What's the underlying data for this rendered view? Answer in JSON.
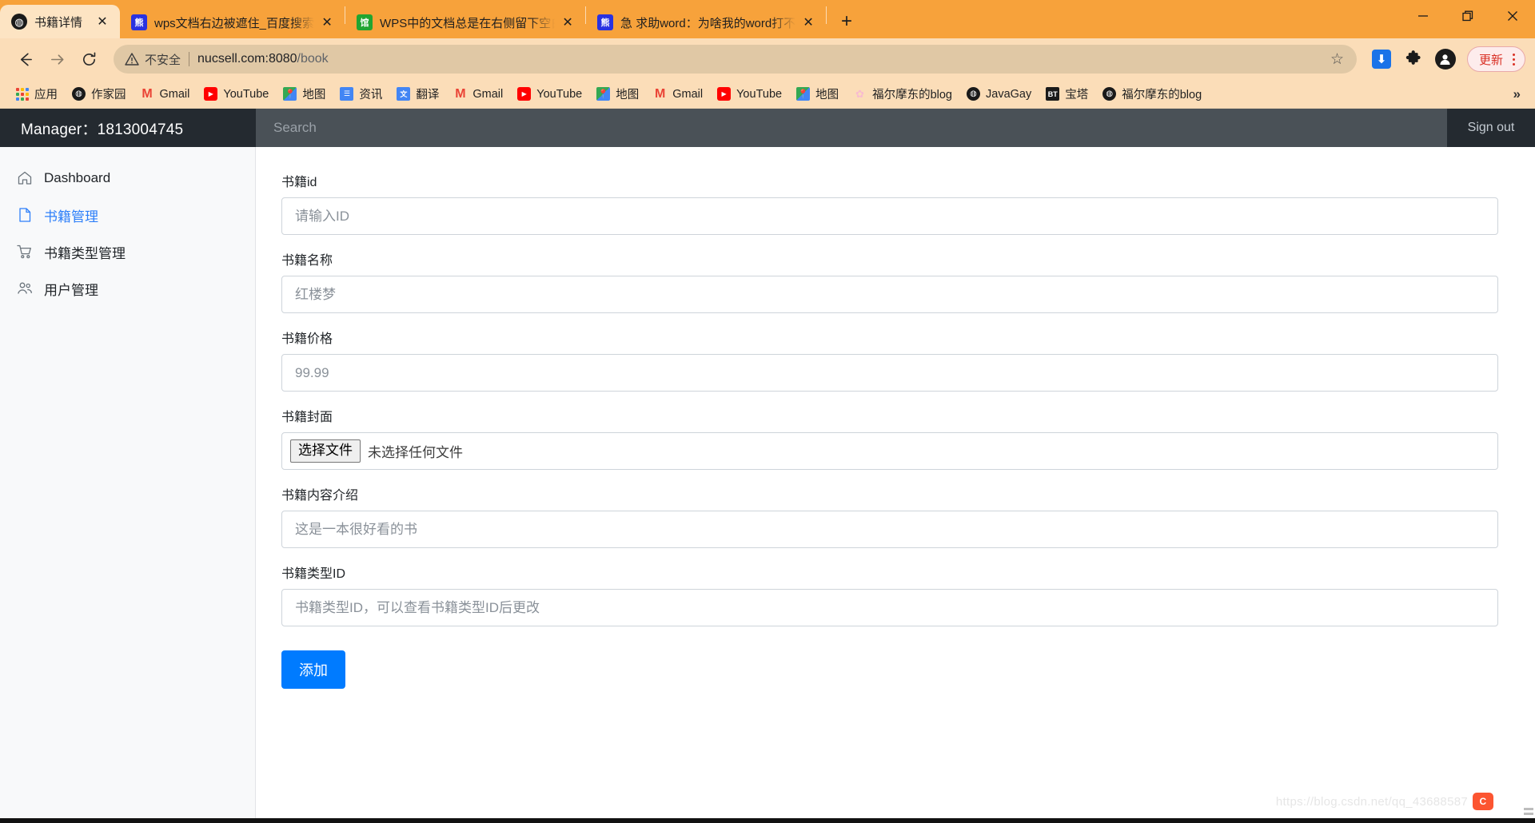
{
  "browser": {
    "tabs": [
      {
        "title": "书籍详情",
        "favicon": "globe-icon",
        "active": true,
        "close_label": "✕"
      },
      {
        "title": "wps文档右边被遮住_百度搜索",
        "favicon": "baidu-icon",
        "active": false,
        "close_label": "✕"
      },
      {
        "title": "WPS中的文档总是在右侧留下空白",
        "favicon": "wps-doc-icon",
        "active": false,
        "close_label": "✕"
      },
      {
        "title": "急 求助word：为啥我的word打不开",
        "favicon": "baidu-icon",
        "active": false,
        "close_label": "✕"
      }
    ],
    "new_tab_label": "+",
    "window_controls": {
      "minimize": "—",
      "maximize": "❐",
      "close": "✕"
    },
    "nav": {
      "back": "back-icon",
      "forward": "forward-icon",
      "reload": "reload-icon"
    },
    "omnibox": {
      "security_label": "不安全",
      "url_host": "nucsell.com:8080",
      "url_path": "/book",
      "star": "☆"
    },
    "toolbar_right": {
      "extension_badge": "⬇",
      "puzzle": "extensions-icon",
      "profile": "profile-icon",
      "update_label": "更新",
      "menu": "kebab-menu-icon"
    },
    "bookmarks": [
      {
        "label": "应用",
        "icon": "apps-grid-icon",
        "color": "#4285f4"
      },
      {
        "label": "作家园",
        "icon": "globe-icon",
        "color": "#1a1a1a"
      },
      {
        "label": "Gmail",
        "icon": "gmail-icon",
        "color": "#ea4335"
      },
      {
        "label": "YouTube",
        "icon": "youtube-icon",
        "color": "#ff0000"
      },
      {
        "label": "地图",
        "icon": "maps-icon",
        "color": "#34a853"
      },
      {
        "label": "资讯",
        "icon": "news-icon",
        "color": "#4285f4"
      },
      {
        "label": "翻译",
        "icon": "translate-icon",
        "color": "#4285f4"
      },
      {
        "label": "Gmail",
        "icon": "gmail-icon",
        "color": "#ea4335"
      },
      {
        "label": "YouTube",
        "icon": "youtube-icon",
        "color": "#ff0000"
      },
      {
        "label": "地图",
        "icon": "maps-icon",
        "color": "#34a853"
      },
      {
        "label": "Gmail",
        "icon": "gmail-icon",
        "color": "#ea4335"
      },
      {
        "label": "YouTube",
        "icon": "youtube-icon",
        "color": "#ff0000"
      },
      {
        "label": "地图",
        "icon": "maps-icon",
        "color": "#34a853"
      },
      {
        "label": "福尔摩东的blog",
        "icon": "flower-icon",
        "color": "#f8bbd0"
      },
      {
        "label": "JavaGay",
        "icon": "globe-icon",
        "color": "#1a1a1a"
      },
      {
        "label": "宝塔",
        "icon": "bt-icon",
        "color": "#1a1a1a"
      },
      {
        "label": "福尔摩东的blog",
        "icon": "globe-icon",
        "color": "#1a1a1a"
      }
    ],
    "bookmarks_overflow": "»"
  },
  "app": {
    "brand": "Manager：1813004745",
    "search": {
      "value": "",
      "placeholder": "Search"
    },
    "sign_out": "Sign out",
    "sidebar": {
      "items": [
        {
          "label": "Dashboard",
          "icon": "home-icon",
          "active": false
        },
        {
          "label": "书籍管理",
          "icon": "file-icon",
          "active": true
        },
        {
          "label": "书籍类型管理",
          "icon": "cart-icon",
          "active": false
        },
        {
          "label": "用户管理",
          "icon": "users-icon",
          "active": false
        }
      ]
    },
    "form": {
      "fields": [
        {
          "label": "书籍id",
          "placeholder": "请输入ID",
          "value": "",
          "type": "text"
        },
        {
          "label": "书籍名称",
          "placeholder": "红楼梦",
          "value": "",
          "type": "text"
        },
        {
          "label": "书籍价格",
          "placeholder": "99.99",
          "value": "",
          "type": "text"
        },
        {
          "label": "书籍封面",
          "placeholder": "",
          "value": "",
          "type": "file",
          "file_button": "选择文件",
          "file_status": "未选择任何文件"
        },
        {
          "label": "书籍内容介绍",
          "placeholder": "这是一本很好看的书",
          "value": "",
          "type": "text"
        },
        {
          "label": "书籍类型ID",
          "placeholder": "书籍类型ID，可以查看书籍类型ID后更改",
          "value": "",
          "type": "text"
        }
      ],
      "submit_label": "添加"
    },
    "watermark": "https://blog.csdn.net/qq_43688587"
  },
  "colors": {
    "tabstrip": "#f7a23b",
    "toolbar": "#fbddb8",
    "active_tab": "#fde4c3",
    "appbar": "#242a30",
    "search_field": "#4a5157",
    "sidebar": "#f8f9fa",
    "accent": "#007bff",
    "active_nav": "#2d7ff9",
    "update": "#d93025"
  }
}
